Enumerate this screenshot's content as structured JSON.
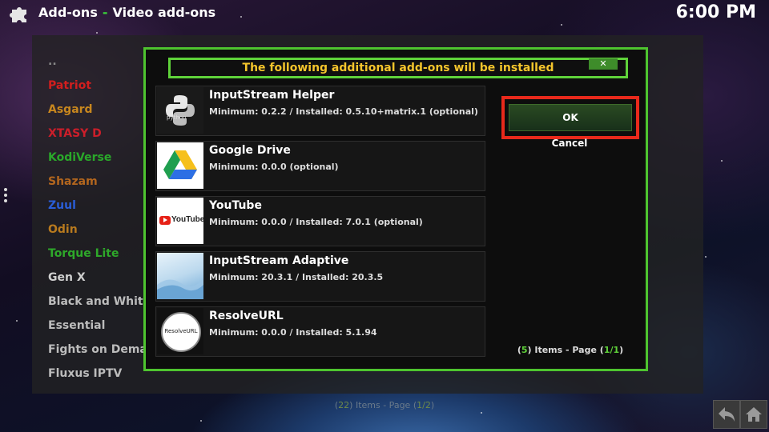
{
  "header": {
    "section": "Add-ons",
    "category": "Video add-ons",
    "time": "6:00 PM"
  },
  "background_list": {
    "top": "..",
    "items": [
      {
        "label": "Patriot",
        "color": "#d21e1e"
      },
      {
        "label": "Asgard",
        "color": "#c8871e"
      },
      {
        "label": "XTASY D",
        "color": "#cc1e2a"
      },
      {
        "label": "KodiVerse",
        "color": "#2aa82a"
      },
      {
        "label": "Shazam",
        "color": "#b3661e"
      },
      {
        "label": "Zuul",
        "color": "#2a5ed8"
      },
      {
        "label": "Odin",
        "color": "#b87a1e"
      },
      {
        "label": "Torque Lite",
        "color": "#2ea82a"
      },
      {
        "label": "Gen X",
        "color": "#cfcfcf"
      },
      {
        "label": "Black and White M",
        "color": "#bcbcbc"
      },
      {
        "label": "Essential",
        "color": "#bcbcbc"
      },
      {
        "label": "Fights on Demand",
        "color": "#bcbcbc"
      },
      {
        "label": "Fluxus IPTV",
        "color": "#bcbcbc"
      }
    ],
    "footer": {
      "count": "22",
      "items_label": "Items - Page",
      "page": "1/2"
    }
  },
  "dialog": {
    "title": "The following additional add-ons will be installed",
    "close_label": "✕",
    "ok_label": "OK",
    "cancel_label": "Cancel",
    "footer": {
      "count": "5",
      "items_label": "Items - Page",
      "page": "1/1"
    },
    "addons": [
      {
        "name": "InputStream Helper",
        "desc": "Minimum: 0.2.2 / Installed: 0.5.10+matrix.1 (optional)",
        "thumb_text": "python"
      },
      {
        "name": "Google Drive",
        "desc": "Minimum: 0.0.0 (optional)",
        "thumb_text": ""
      },
      {
        "name": "YouTube",
        "desc": "Minimum: 0.0.0 / Installed: 7.0.1 (optional)",
        "thumb_text": "YouTube"
      },
      {
        "name": "InputStream Adaptive",
        "desc": "Minimum: 20.3.1 / Installed: 20.3.5",
        "thumb_text": ""
      },
      {
        "name": "ResolveURL",
        "desc": "Minimum: 0.0.0 / Installed: 5.1.94",
        "thumb_text": "ResolveURL"
      }
    ]
  },
  "colors": {
    "accent": "#4ec42f",
    "title": "#f5c52c",
    "highlight": "#e8291b"
  }
}
